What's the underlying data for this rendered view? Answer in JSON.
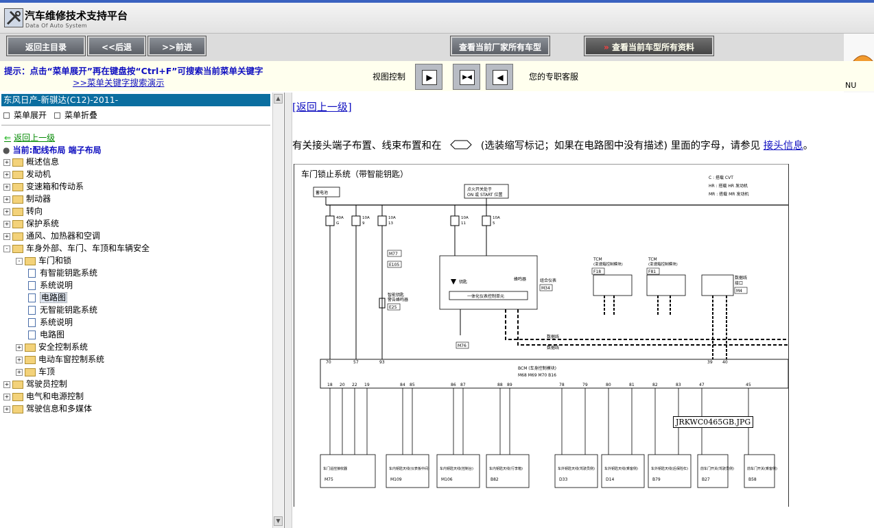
{
  "app": {
    "title": "汽车维修技术支持平台",
    "subtitle": "Data Of Auto System"
  },
  "toolbar": {
    "home_label": "返回主目录",
    "back_label": "<<后退",
    "forward_label": ">>前进",
    "all_models_label": "查看当前厂家所有车型",
    "all_data_label": "查看当前车型所有资料"
  },
  "hint": {
    "text": "提示：点击“菜单展开”再在键盘按“Ctrl+F”可搜索当前菜单关键字",
    "link": ">>菜单关键字搜索演示"
  },
  "view_control": {
    "label": "视图控制"
  },
  "service": {
    "text": "您的专职客服",
    "badge": "NU"
  },
  "sidebar": {
    "vehicle": "东风日产-新骐达(C12)-2011-",
    "expand_label": "菜单展开",
    "collapse_label": "菜单折叠",
    "back_up": "返回上一级",
    "current": "当前:配线布局  端子布局",
    "tree": [
      {
        "label": "概述信息",
        "level": 0,
        "type": "folder",
        "toggle": "+"
      },
      {
        "label": "发动机",
        "level": 0,
        "type": "folder",
        "toggle": "+"
      },
      {
        "label": "变速箱和传动系",
        "level": 0,
        "type": "folder",
        "toggle": "+"
      },
      {
        "label": "制动器",
        "level": 0,
        "type": "folder",
        "toggle": "+"
      },
      {
        "label": "转向",
        "level": 0,
        "type": "folder",
        "toggle": "+"
      },
      {
        "label": "保护系统",
        "level": 0,
        "type": "folder",
        "toggle": "+"
      },
      {
        "label": "通风、加热器和空调",
        "level": 0,
        "type": "folder",
        "toggle": "+"
      },
      {
        "label": "车身外部、车门、车顶和车辆安全",
        "level": 0,
        "type": "folder",
        "toggle": "-"
      },
      {
        "label": "车门和锁",
        "level": 1,
        "type": "folder",
        "toggle": "-"
      },
      {
        "label": "有智能钥匙系统",
        "level": 2,
        "type": "doc"
      },
      {
        "label": "系统说明",
        "level": 2,
        "type": "doc"
      },
      {
        "label": "电路图",
        "level": 2,
        "type": "doc",
        "selected": true
      },
      {
        "label": "无智能钥匙系统",
        "level": 2,
        "type": "doc"
      },
      {
        "label": "系统说明",
        "level": 2,
        "type": "doc"
      },
      {
        "label": "电路图",
        "level": 2,
        "type": "doc"
      },
      {
        "label": "安全控制系统",
        "level": 1,
        "type": "folder",
        "toggle": "+"
      },
      {
        "label": "电动车窗控制系统",
        "level": 1,
        "type": "folder",
        "toggle": "+"
      },
      {
        "label": "车顶",
        "level": 1,
        "type": "folder",
        "toggle": "+"
      },
      {
        "label": "驾驶员控制",
        "level": 0,
        "type": "folder",
        "toggle": "+"
      },
      {
        "label": "电气和电源控制",
        "level": 0,
        "type": "folder",
        "toggle": "+"
      },
      {
        "label": "驾驶信息和多媒体",
        "level": 0,
        "type": "folder",
        "toggle": "+"
      }
    ]
  },
  "content": {
    "back_link": "[返回上一级]",
    "desc_before": "有关接头端子布置、线束布置和在",
    "desc_after": "(选装缩写标记；如果在电路图中没有描述) 里面的字母，请参见",
    "desc_link": "接头信息",
    "desc_end": "。",
    "diagram": {
      "title": "车门锁止系统（带智能钥匙）",
      "legend": [
        "C : 搭载 CVT",
        "HR : 搭载 HR 发动机",
        "MR : 搭载 MR 发动机"
      ],
      "battery": "蓄电池",
      "ignition": [
        "点火开关处于",
        "ON 或 START 位置"
      ],
      "fuses": [
        {
          "rating": "40A",
          "id": "G"
        },
        {
          "rating": "10A",
          "id": "9"
        },
        {
          "rating": "10A",
          "id": "13"
        },
        {
          "rating": "10A",
          "id": "11"
        },
        {
          "rating": "10A",
          "id": "5"
        }
      ],
      "connectors": [
        "M77",
        "E105",
        "M34",
        "M76",
        "E25",
        "M4",
        "F18",
        "F81"
      ],
      "combination_meter": [
        "组合仪表",
        "M34"
      ],
      "buzzer_unit": "一体化仪表控制单元",
      "buzzer": "蜂鸣器",
      "key_label": "钥匙",
      "smart_key_warning": [
        "智能钥匙",
        "警告蜂鸣器",
        "E25"
      ],
      "tcm": [
        "TCM",
        "(变速箱控制模块)"
      ],
      "data_link": [
        "数据线",
        "接口"
      ],
      "bcm": [
        "BCM (车身控制模块)",
        "M68 M69 M70 B16"
      ],
      "data_line": "数据线",
      "top_pins": [
        "70",
        "57",
        "93",
        "39",
        "40"
      ],
      "bottom_pins": [
        "18",
        "20",
        "22",
        "19",
        "84",
        "85",
        "86",
        "87",
        "88",
        "89",
        "78",
        "79",
        "80",
        "81",
        "82",
        "83",
        "47",
        "45"
      ],
      "loads": [
        {
          "name": "车门遥控接收器",
          "conn": "M75"
        },
        {
          "name": "车内钥匙天线(仪表板中间)",
          "conn": "M109"
        },
        {
          "name": "车内钥匙天线(控制台)",
          "conn": "M106"
        },
        {
          "name": "车内钥匙天线(行李箱)",
          "conn": "B82"
        },
        {
          "name": "车外钥匙天线(驾驶员侧)",
          "conn": "D33"
        },
        {
          "name": "车外钥匙天线(乘客侧)",
          "conn": "D14"
        },
        {
          "name": "车外钥匙天线(后保险杠)",
          "conn": "B79"
        },
        {
          "name": "前车门开关(驾驶员侧)",
          "conn": "B27"
        },
        {
          "name": "前车门开关(乘客侧)",
          "conn": "B58"
        }
      ],
      "tooltip": "JRKWC0465GB.JPG"
    }
  }
}
